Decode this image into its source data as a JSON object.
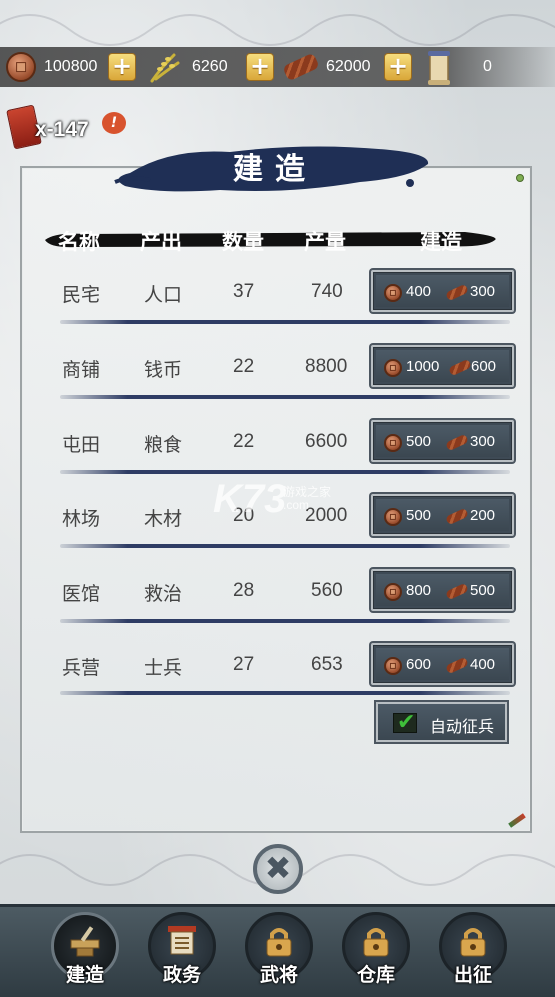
{
  "resources": [
    {
      "name": "copper-coins",
      "value": "100800",
      "has_plus": true
    },
    {
      "name": "grain",
      "value": "6260",
      "has_plus": true
    },
    {
      "name": "timber",
      "value": "62000",
      "has_plus": true
    },
    {
      "name": "scroll",
      "value": "0",
      "has_plus": false
    }
  ],
  "plus_symbol": "+",
  "badge": {
    "text": "x-147",
    "alert": "!"
  },
  "panel": {
    "title": "建造",
    "headers": {
      "name": "名称",
      "output": "产出",
      "count": "数量",
      "production": "产量",
      "build": "建造"
    },
    "rows": [
      {
        "name": "民宅",
        "output": "人口",
        "count": "37",
        "production": "740",
        "coin_cost": "400",
        "wood_cost": "300"
      },
      {
        "name": "商铺",
        "output": "钱币",
        "count": "22",
        "production": "8800",
        "coin_cost": "1000",
        "wood_cost": "600"
      },
      {
        "name": "屯田",
        "output": "粮食",
        "count": "22",
        "production": "6600",
        "coin_cost": "500",
        "wood_cost": "300"
      },
      {
        "name": "林场",
        "output": "木材",
        "count": "20",
        "production": "2000",
        "coin_cost": "500",
        "wood_cost": "200"
      },
      {
        "name": "医馆",
        "output": "救治",
        "count": "28",
        "production": "560",
        "coin_cost": "800",
        "wood_cost": "500"
      },
      {
        "name": "兵营",
        "output": "士兵",
        "count": "27",
        "production": "653",
        "coin_cost": "600",
        "wood_cost": "400"
      }
    ],
    "auto_recruit": {
      "label": "自动征兵",
      "checked": true,
      "check_symbol": "✔"
    }
  },
  "watermark": {
    "logo": "K73",
    "sub": "游戏之家",
    "url": ".com"
  },
  "close_symbol": "✖",
  "bottom_nav": [
    {
      "label": "建造",
      "active": true
    },
    {
      "label": "政务",
      "active": false
    },
    {
      "label": "武将",
      "active": false
    },
    {
      "label": "仓库",
      "active": false
    },
    {
      "label": "出征",
      "active": false
    }
  ],
  "colors": {
    "panel_line": "#2e3c64",
    "button_bg": "#3e4a55",
    "plus_gold": "#e2b94c",
    "check_green": "#3fbf3a"
  }
}
